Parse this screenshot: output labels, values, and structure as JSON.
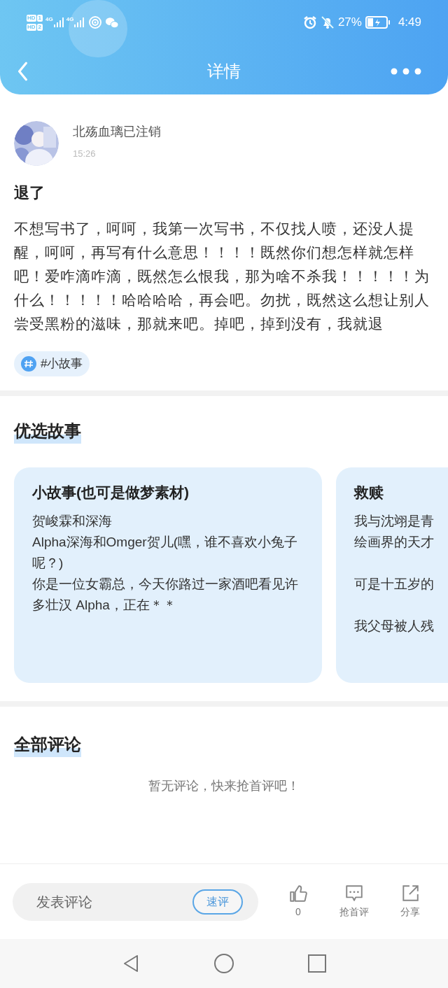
{
  "status_bar": {
    "sims": [
      {
        "badge": "HD",
        "slot": "1"
      },
      {
        "badge": "HD",
        "slot": "2"
      }
    ],
    "networks": [
      "4G",
      "4G"
    ],
    "battery": "27%",
    "time": "4:49"
  },
  "header": {
    "title": "详情"
  },
  "post": {
    "author": "北殇血璃已注销",
    "time": "15:26",
    "title": "退了",
    "body": "不想写书了，呵呵，我第一次写书，不仅找人喷，还没人提醒，呵呵，再写有什么意思！！！！既然你们想怎样就怎样吧！爱咋滴咋滴，既然怎么恨我，那为啥不杀我！！！！！为什么！！！！！哈哈哈哈，再会吧。勿扰，既然这么想让别人尝受黑粉的滋味，那就来吧。掉吧，掉到没有，我就退",
    "tag": "#小故事"
  },
  "featured": {
    "heading": "优选故事",
    "stories": [
      {
        "title": "小故事(也可是做梦素材)",
        "paragraphs": [
          [
            "贺峻霖和深海",
            "Alpha深海和Omger贺儿(嘿，谁不喜欢小兔子呢？)",
            "你是一位女霸总，今天你路过一家酒吧看见许多壮汉 Alpha，正在＊＊"
          ]
        ]
      },
      {
        "title": "救赎",
        "paragraphs": [
          [
            "我与沈翊是青",
            "绘画界的天才"
          ],
          [
            "可是十五岁的"
          ],
          [
            "我父母被人残"
          ]
        ]
      }
    ]
  },
  "comments": {
    "heading": "全部评论",
    "empty": "暂无评论，快来抢首评吧！"
  },
  "bottom_bar": {
    "placeholder": "发表评论",
    "quick": "速评",
    "actions": [
      {
        "kind": "like",
        "label": "0"
      },
      {
        "kind": "comment",
        "label": "抢首评"
      },
      {
        "kind": "share",
        "label": "分享"
      }
    ]
  }
}
